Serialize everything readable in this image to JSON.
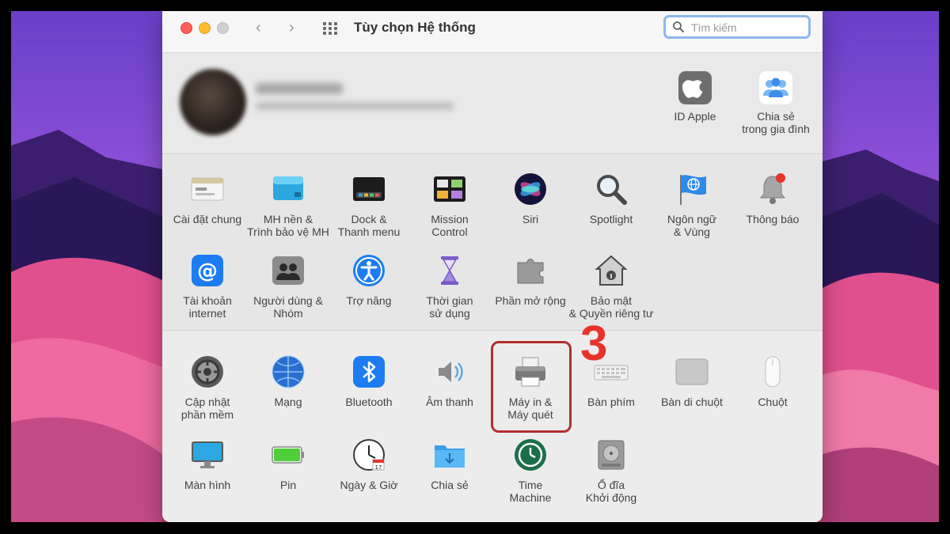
{
  "window": {
    "title": "Tùy chọn Hệ thống"
  },
  "search": {
    "placeholder": "Tìm kiếm",
    "value": ""
  },
  "account": {
    "items": [
      {
        "name": "id-apple",
        "label": "ID Apple"
      },
      {
        "name": "family-sharing",
        "label": "Chia sẻ\ntrong gia đình"
      }
    ]
  },
  "prefs": {
    "row1": [
      {
        "label": "Cài đặt chung"
      },
      {
        "label": "MH nền &\nTrình bảo vệ MH"
      },
      {
        "label": "Dock &\nThanh menu"
      },
      {
        "label": "Mission\nControl"
      },
      {
        "label": "Siri"
      },
      {
        "label": "Spotlight"
      },
      {
        "label": "Ngôn ngữ\n& Vùng"
      },
      {
        "label": "Thông báo"
      }
    ],
    "row2": [
      {
        "label": "Tài khoản\ninternet"
      },
      {
        "label": "Người dùng &\nNhóm"
      },
      {
        "label": "Trợ năng"
      },
      {
        "label": "Thời gian\nsử dụng"
      },
      {
        "label": "Phần mở rộng"
      },
      {
        "label": "Bảo mật\n& Quyền riêng tư"
      }
    ],
    "row3": [
      {
        "label": "Cập nhật\nphần mềm"
      },
      {
        "label": "Mạng"
      },
      {
        "label": "Bluetooth"
      },
      {
        "label": "Âm thanh"
      },
      {
        "label": "Máy in &\nMáy quét"
      },
      {
        "label": "Bàn phím"
      },
      {
        "label": "Bàn di chuột"
      },
      {
        "label": "Chuột"
      }
    ],
    "row4": [
      {
        "label": "Màn hình"
      },
      {
        "label": "Pin"
      },
      {
        "label": "Ngày & Giờ"
      },
      {
        "label": "Chia sẻ"
      },
      {
        "label": "Time\nMachine"
      },
      {
        "label": "Ổ đĩa\nKhởi động"
      }
    ]
  },
  "annotation": {
    "step": "3",
    "color": "#e8332a"
  },
  "colors": {
    "highlight": "#b0302e",
    "search_focus": "#8fb7e9",
    "accent": "#1e7cf2"
  }
}
